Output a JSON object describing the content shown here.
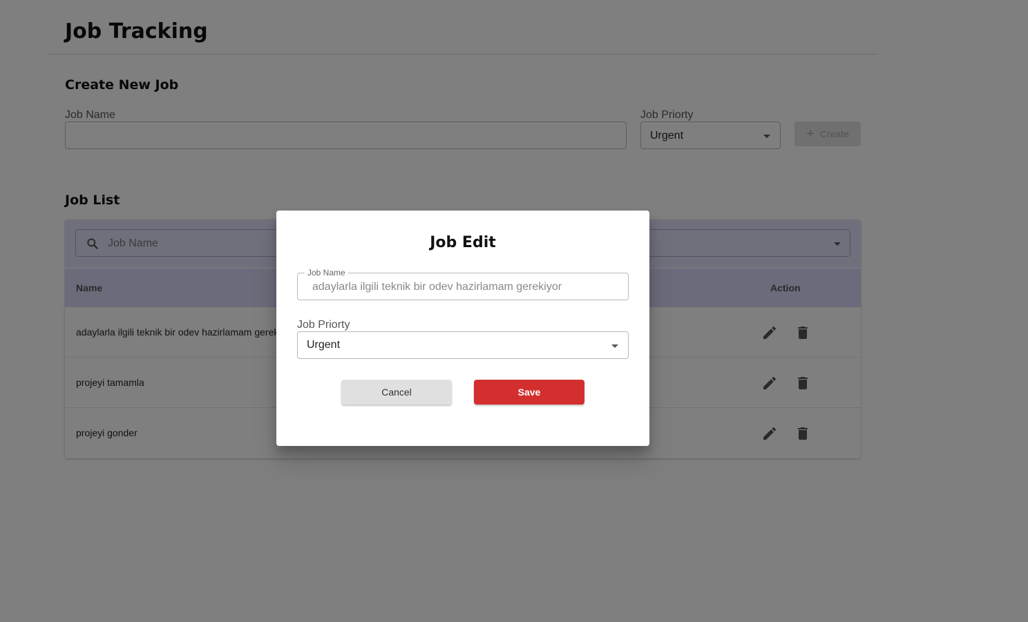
{
  "header": {
    "title": "Job Tracking"
  },
  "create": {
    "title": "Create New Job",
    "name_label": "Job Name",
    "name_value": "",
    "priority_label": "Job Priorty",
    "priority_value": "Urgent",
    "button_label": "Create"
  },
  "list": {
    "title": "Job List",
    "search_placeholder": "Job Name",
    "filter_value": "",
    "columns": {
      "name": "Name",
      "action": "Action"
    },
    "rows": [
      {
        "name": "adaylarla ilgili teknik bir odev hazirlamam gerekiyor"
      },
      {
        "name": "projeyi tamamla"
      },
      {
        "name": "projeyi gonder"
      }
    ]
  },
  "modal": {
    "title": "Job Edit",
    "name_label": "Job Name",
    "name_value": "adaylarla ilgili teknik bir odev hazirlamam gerekiyor",
    "priority_label": "Job Priorty",
    "priority_value": "Urgent",
    "cancel_label": "Cancel",
    "save_label": "Save"
  },
  "colors": {
    "overlay": "rgba(0,0,0,0.5)",
    "save": "#d32f2f",
    "filter_bar": "#e0e0fb",
    "table_header": "#d6d6f6"
  },
  "icons": [
    "search-icon",
    "plus-icon",
    "edit-icon",
    "delete-icon",
    "chevron-down-icon"
  ]
}
